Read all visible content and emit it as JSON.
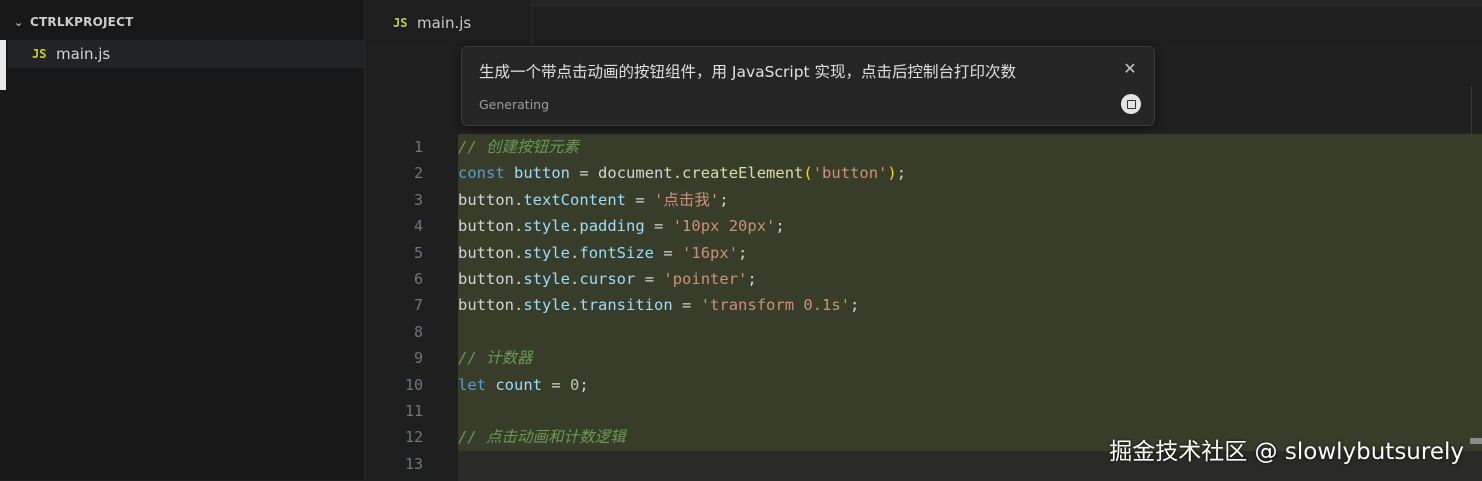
{
  "sidebar": {
    "folder": "CTRLKPROJECT",
    "files": [
      {
        "icon": "JS",
        "name": "main.js"
      }
    ]
  },
  "tabs": [
    {
      "icon": "JS",
      "name": "main.js"
    }
  ],
  "prompt": {
    "text": "生成一个带点击动画的按钮组件，用 JavaScript 实现，点击后控制台打印次数",
    "status": "Generating"
  },
  "editor": {
    "line_numbers": [
      "1",
      "2",
      "3",
      "4",
      "5",
      "6",
      "7",
      "8",
      "9",
      "10",
      "11",
      "12",
      "13"
    ],
    "lines": [
      "// 创建按钮元素",
      "const button = document.createElement('button');",
      "button.textContent = '点击我';",
      "button.style.padding = '10px 20px';",
      "button.style.fontSize = '16px';",
      "button.style.cursor = 'pointer';",
      "button.style.transition = 'transform 0.1s';",
      "",
      "// 计数器",
      "let count = 0;",
      "",
      "// 点击动画和计数逻辑",
      ""
    ]
  },
  "watermark": "掘金技术社区 @ slowlybutsurely",
  "colors": {
    "highlight": "#373d29",
    "background": "#1f1f1f",
    "js_icon": "#cbcb41"
  }
}
